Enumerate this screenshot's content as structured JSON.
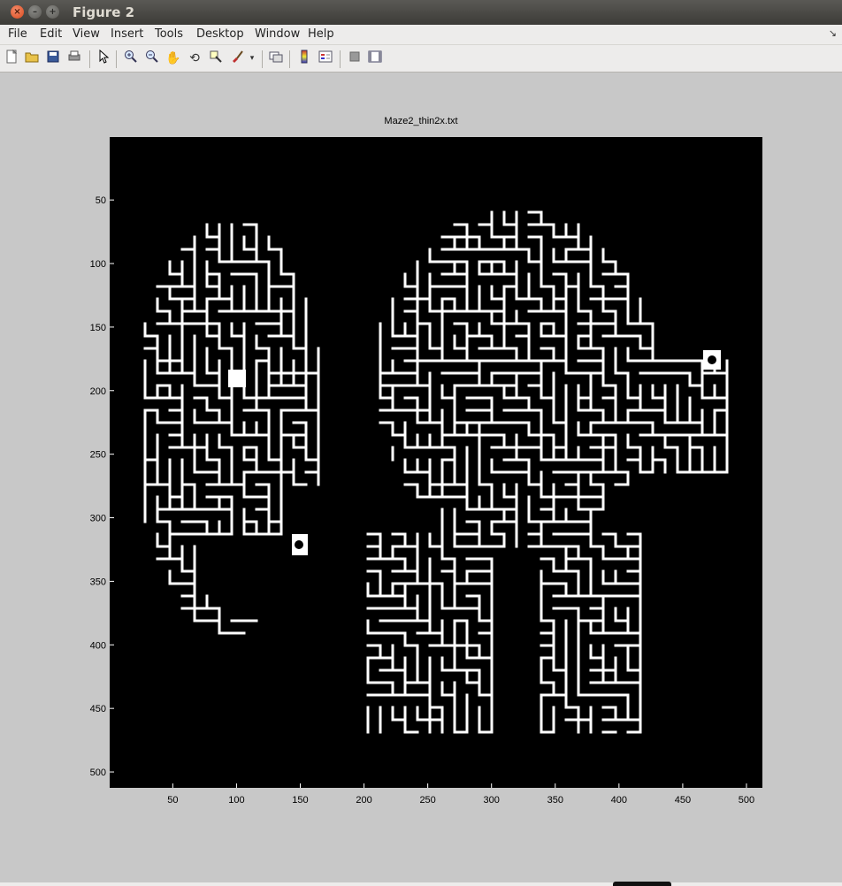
{
  "window": {
    "title": "Figure 2"
  },
  "menu": [
    "File",
    "Edit",
    "View",
    "Insert",
    "Tools",
    "Desktop",
    "Window",
    "Help"
  ],
  "toolbar": {
    "buttons": [
      {
        "name": "new-figure-icon"
      },
      {
        "name": "open-file-icon"
      },
      {
        "name": "save-figure-icon"
      },
      {
        "name": "print-figure-icon"
      },
      {
        "name": "edit-plot-arrow-icon"
      },
      {
        "name": "zoom-in-icon"
      },
      {
        "name": "zoom-out-icon"
      },
      {
        "name": "pan-hand-icon"
      },
      {
        "name": "rotate-3d-icon"
      },
      {
        "name": "data-cursor-icon"
      },
      {
        "name": "brush-icon"
      },
      {
        "name": "brush-dropdown-icon"
      },
      {
        "name": "link-plot-icon"
      },
      {
        "name": "insert-colorbar-icon"
      },
      {
        "name": "insert-legend-icon"
      },
      {
        "name": "hide-plot-tools-icon"
      },
      {
        "name": "show-plot-tools-icon"
      }
    ]
  },
  "chart_data": {
    "type": "heatmap",
    "title": "Maze2_thin2x.txt",
    "xlabel": "",
    "ylabel": "",
    "xlim": [
      0.5,
      512.5
    ],
    "ylim": [
      0.5,
      512.5
    ],
    "xticks": [
      50,
      100,
      150,
      200,
      250,
      300,
      350,
      400,
      450,
      500
    ],
    "yticks": [
      50,
      100,
      150,
      200,
      250,
      300,
      350,
      400,
      450,
      500
    ],
    "colormap": [
      "#000000",
      "#ffffff"
    ],
    "y_direction": "reverse"
  }
}
